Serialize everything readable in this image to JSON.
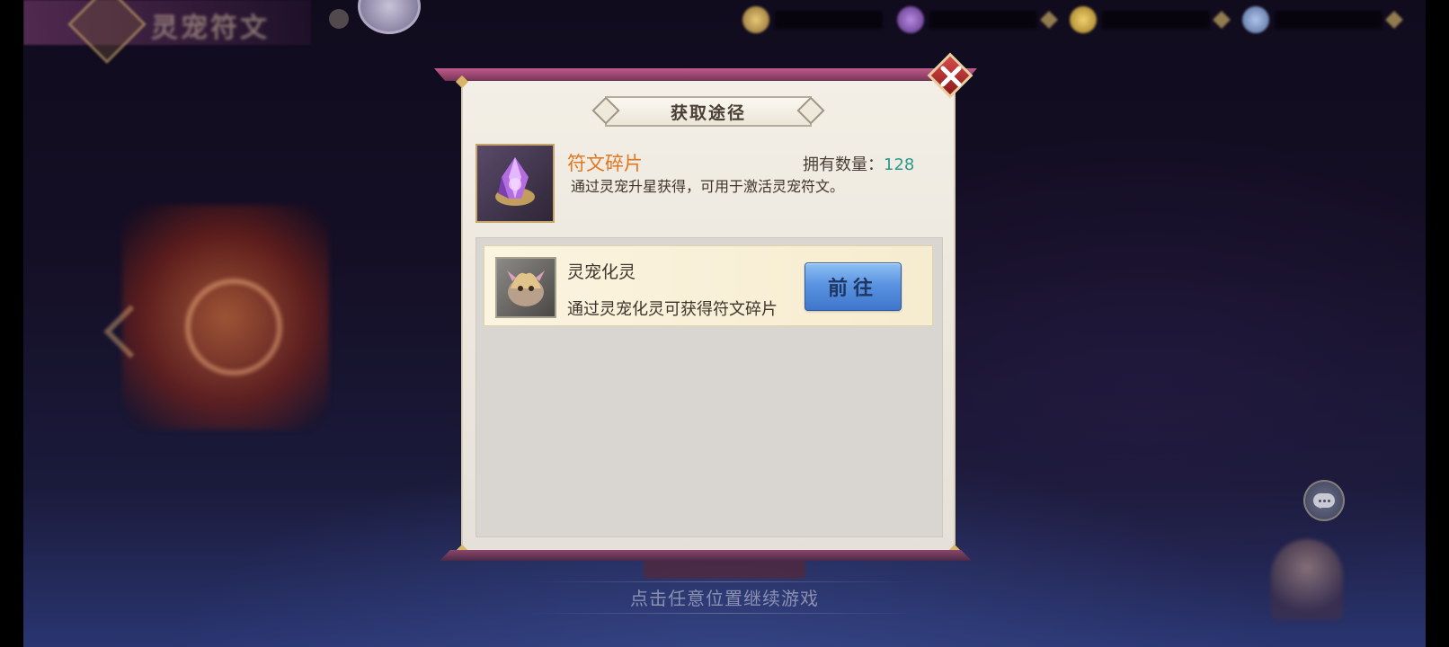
{
  "background": {
    "banner_title": "灵宠符文",
    "continue_hint": "点击任意位置继续游戏"
  },
  "dialog": {
    "title": "获取途径",
    "item": {
      "name": "符文碎片",
      "icon": "purple-crystal-icon",
      "owned_label": "拥有数量：",
      "owned_count": "128",
      "description": "通过灵宠升星获得，可用于激活灵宠符文。"
    },
    "sources": [
      {
        "name": "灵宠化灵",
        "icon": "pet-dragon-icon",
        "description": "通过灵宠化灵可获得符文碎片",
        "button_label": "前往"
      }
    ]
  },
  "colors": {
    "item_name": "#e0761e",
    "owned_count": "#2a9a8a",
    "goto_button": "#5a93e0",
    "close_button": "#c83636"
  }
}
